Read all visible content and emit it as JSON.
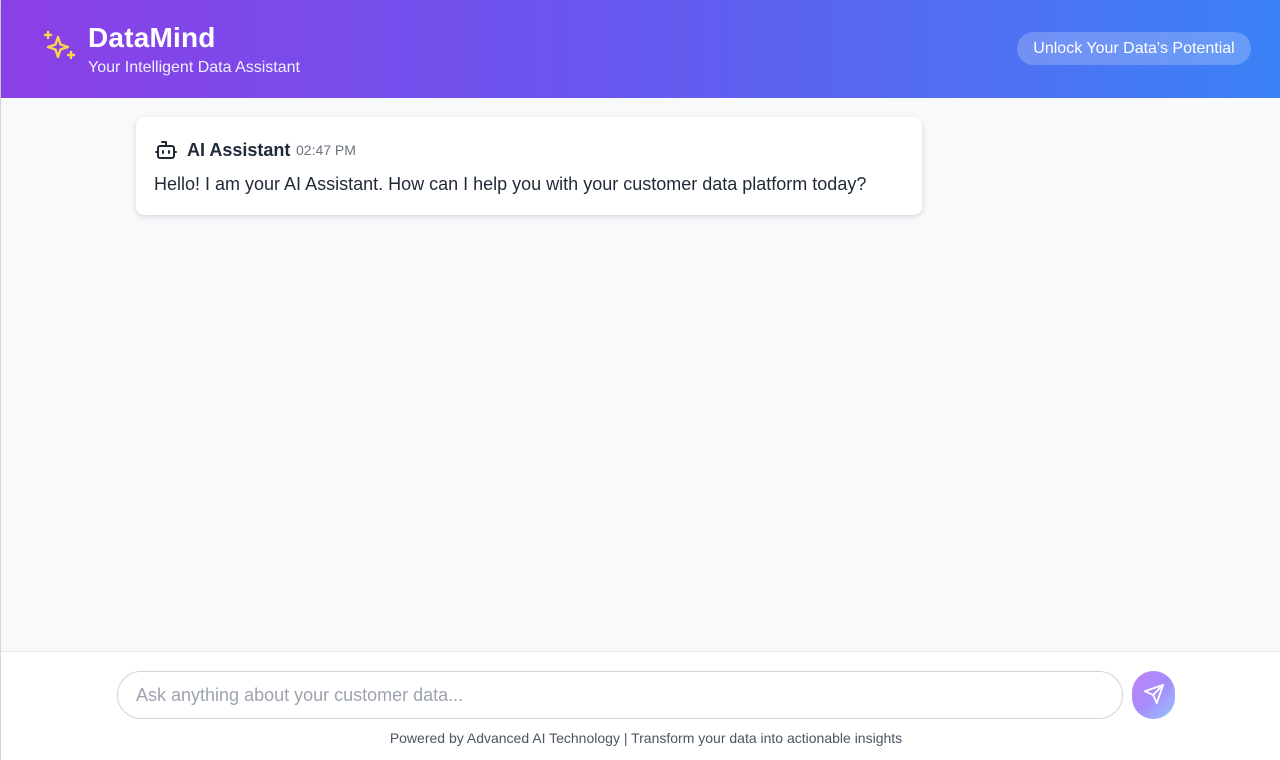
{
  "header": {
    "title": "DataMind",
    "subtitle": "Your Intelligent Data Assistant",
    "pill_label": "Unlock Your Data's Potential",
    "brand_icon": "sparkles-icon",
    "gradient_start": "#8b3fe6",
    "gradient_end": "#3b82f6",
    "icon_color": "#fcd34d"
  },
  "messages": [
    {
      "sender": "AI Assistant",
      "time": "02:47 PM",
      "icon": "bot-icon",
      "text": "Hello! I am your AI Assistant. How can I help you with your customer data platform today?"
    }
  ],
  "composer": {
    "placeholder": "Ask anything about your customer data...",
    "value": "",
    "send_icon": "send-icon"
  },
  "footer": {
    "note": "Powered by Advanced AI Technology | Transform your data into actionable insights"
  }
}
